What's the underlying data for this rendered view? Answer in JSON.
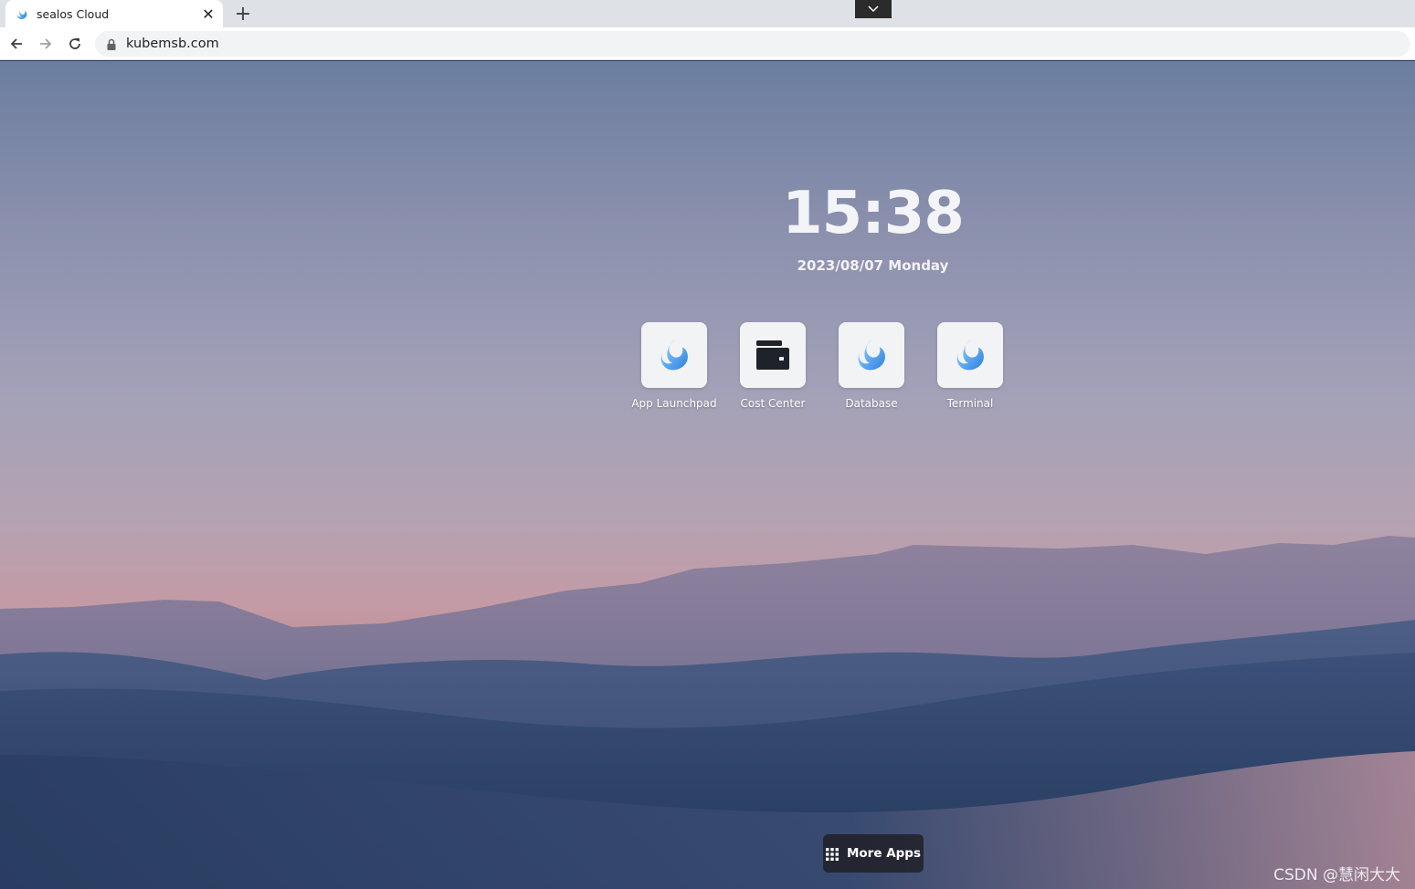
{
  "browser": {
    "tab": {
      "title": "sealos Cloud",
      "favicon": "sealos-logo-icon",
      "close_icon": "close-icon"
    },
    "new_tab_icon": "plus-icon",
    "tab_search_icon": "chevron-down-icon",
    "nav": {
      "back_icon": "arrow-left-icon",
      "forward_icon": "arrow-right-icon",
      "reload_icon": "reload-icon"
    },
    "address": {
      "lock_icon": "lock-icon",
      "url": "kubemsb.com"
    }
  },
  "desktop": {
    "clock": "15:38",
    "date": "2023/08/07 Monday",
    "apps": [
      {
        "label": "App Launchpad",
        "icon": "sealos-logo-icon"
      },
      {
        "label": "Cost Center",
        "icon": "wallet-icon"
      },
      {
        "label": "Database",
        "icon": "sealos-logo-icon"
      },
      {
        "label": "Terminal",
        "icon": "sealos-logo-icon"
      }
    ],
    "more_apps": {
      "label": "More Apps",
      "icon": "grid-icon"
    }
  },
  "watermark": "CSDN @慧闲大大",
  "colors": {
    "accent": "#3a9cf0",
    "tile_bg": "#f2f3f5",
    "dock_bg": "#1e1e23"
  }
}
